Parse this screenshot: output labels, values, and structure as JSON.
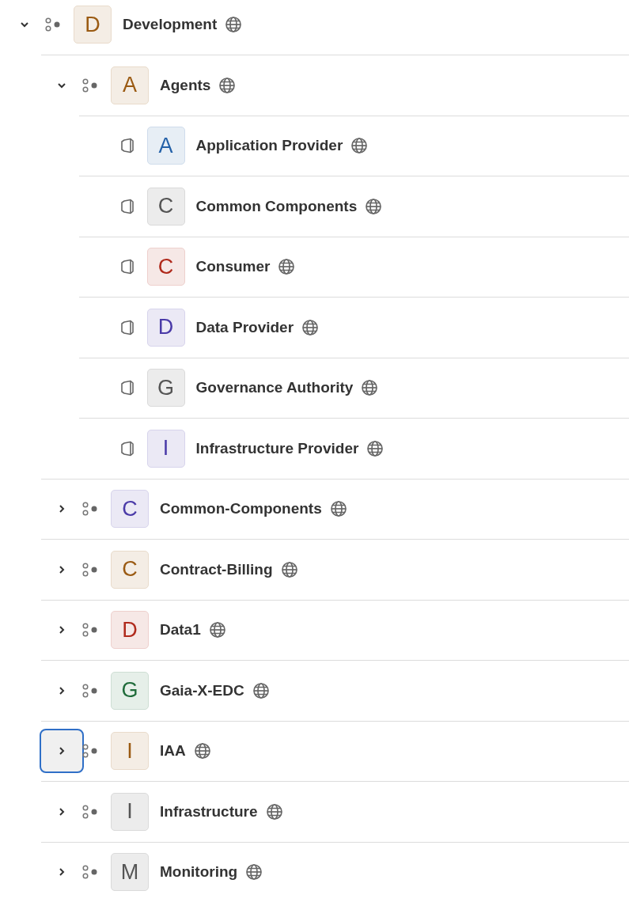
{
  "tree": [
    {
      "kind": "group",
      "letter": "D",
      "name": "Development",
      "color": "#9a5a12",
      "expanded": true,
      "focused": false,
      "children": [
        {
          "kind": "group",
          "letter": "A",
          "name": "Agents",
          "color": "#9a5a12",
          "expanded": true,
          "focused": false,
          "children": [
            {
              "kind": "leaf",
              "letter": "A",
              "name": "Application Provider",
              "color": "#2461a8"
            },
            {
              "kind": "leaf",
              "letter": "C",
              "name": "Common Components",
              "color": "#555555"
            },
            {
              "kind": "leaf",
              "letter": "C",
              "name": "Consumer",
              "color": "#b02a1c"
            },
            {
              "kind": "leaf",
              "letter": "D",
              "name": "Data Provider",
              "color": "#4a3aa8"
            },
            {
              "kind": "leaf",
              "letter": "G",
              "name": "Governance Authority",
              "color": "#555555"
            },
            {
              "kind": "leaf",
              "letter": "I",
              "name": "Infrastructure Provider",
              "color": "#4a3aa8"
            }
          ]
        },
        {
          "kind": "group",
          "letter": "C",
          "name": "Common-Components",
          "color": "#4a3aa8",
          "expanded": false,
          "focused": false
        },
        {
          "kind": "group",
          "letter": "C",
          "name": "Contract-Billing",
          "color": "#9a5a12",
          "expanded": false,
          "focused": false
        },
        {
          "kind": "group",
          "letter": "D",
          "name": "Data1",
          "color": "#b02a1c",
          "expanded": false,
          "focused": false
        },
        {
          "kind": "group",
          "letter": "G",
          "name": "Gaia-X-EDC",
          "color": "#1f6b3a",
          "expanded": false,
          "focused": false
        },
        {
          "kind": "group",
          "letter": "I",
          "name": "IAA",
          "color": "#9a5a12",
          "expanded": false,
          "focused": true
        },
        {
          "kind": "group",
          "letter": "I",
          "name": "Infrastructure",
          "color": "#555555",
          "expanded": false,
          "focused": false
        },
        {
          "kind": "group",
          "letter": "M",
          "name": "Monitoring",
          "color": "#555555",
          "expanded": false,
          "focused": false
        }
      ]
    }
  ]
}
